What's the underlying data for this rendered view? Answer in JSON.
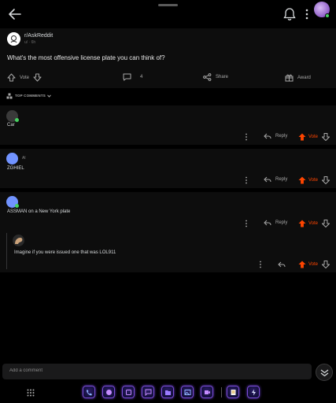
{
  "post": {
    "subreddit": "r/AskReddit",
    "meta": "u/ · 6h",
    "title": "What's the most offensive license plate you can think of?"
  },
  "actions": {
    "vote": "Vote",
    "comments_count": "4",
    "share": "Share",
    "award": "Award"
  },
  "sort": {
    "label": "TOP COMMENTS"
  },
  "comments": [
    {
      "author": "",
      "text": "Car",
      "reply": "Reply",
      "vote": "Vote",
      "avatar_color": "#3a3a3a"
    },
    {
      "author": "Al",
      "text": "ZGHIEL",
      "reply": "Reply",
      "vote": "Vote",
      "avatar_color": "#7193ff"
    },
    {
      "author": "",
      "text": "ASSMAN on a New York plate",
      "reply": "Reply",
      "vote": "Vote",
      "avatar_color": "#7193ff"
    },
    {
      "author": "",
      "text": "Imagine if you were issued one that was LOL911",
      "reply": "",
      "vote": "Vote",
      "avatar_color": "#caa27a"
    }
  ],
  "composer": {
    "placeholder": "Add a comment"
  },
  "colors": {
    "upvote": "#ff4500",
    "online": "#46d160",
    "background": "#000000",
    "card": "#0d0d0d"
  },
  "dock": {
    "apps": [
      "phone-icon",
      "bubble-icon",
      "app-icon",
      "chat-icon",
      "folder-icon",
      "gallery-icon",
      "video-icon",
      "notes-icon",
      "flash-icon"
    ]
  }
}
